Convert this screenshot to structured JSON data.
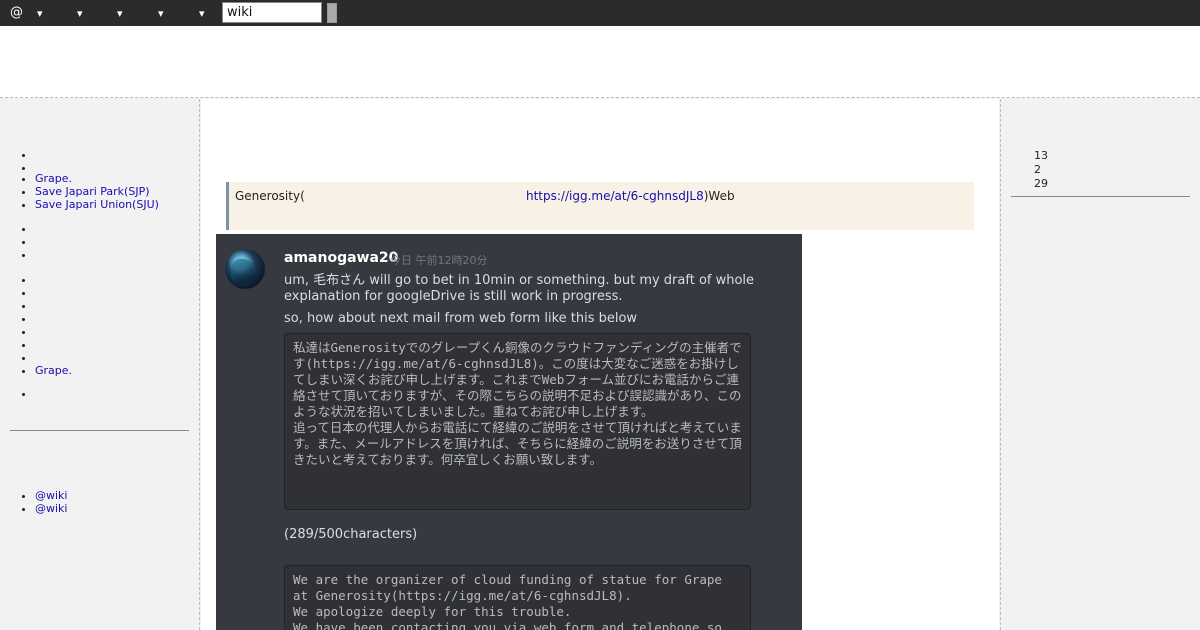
{
  "topbar": {
    "at_label": "@",
    "dropdown_glyph": "▾",
    "search_value": "wiki"
  },
  "left_menu": {
    "group1": [
      "",
      "Grape.",
      "Save Japari Park(SJP)",
      "Save Japari Union(SJU)"
    ],
    "group3_item": "Grape.",
    "footer_links": [
      "@wiki",
      "@wiki"
    ]
  },
  "right_sidebar": {
    "numbers": [
      "13",
      "2",
      "29"
    ]
  },
  "main": {
    "quote_text": "Generosity(",
    "quote_link": "https://igg.me/at/6-cghnsdJL8",
    "quote_suffix": ")Web"
  },
  "message": {
    "username": "amanogawa20",
    "time": "今日 午前12時20分",
    "line1": "um, 毛布さん will go to bet in 10min or something. but my draft of whole explanation for googleDrive is  still work in progress.",
    "line2": "so,  how about  next mail from web form like this below",
    "ja_draft": "私達はGenerosityでのグレープくん銅像のクラウドファンディングの主催者です(https://igg.me/at/6-cghnsdJL8)。この度は大変なご迷惑をお掛けしてしまい深くお詫び申し上げます。これまでWebフォーム並びにお電話からご連絡させて頂いておりますが、その際こちらの説明不足および誤認識があり、このような状況を招いてしまいました。重ねてお詫び申し上げます。\n追って日本の代理人からお電話にて経緯のご説明をさせて頂ければと考えています。また、メールアドレスを頂ければ、そちらに経緯のご説明をお送りさせて頂きたいと考えております。何卒宜しくお願い致します。",
    "char_count": "(289/500characters)",
    "en_draft": "We are the organizer of cloud funding of statue for Grape at Generosity(https://igg.me/at/6-cghnsdJL8).\nWe apologize deeply for this trouble.\nWe have been contacting you via web form and telephone so"
  }
}
